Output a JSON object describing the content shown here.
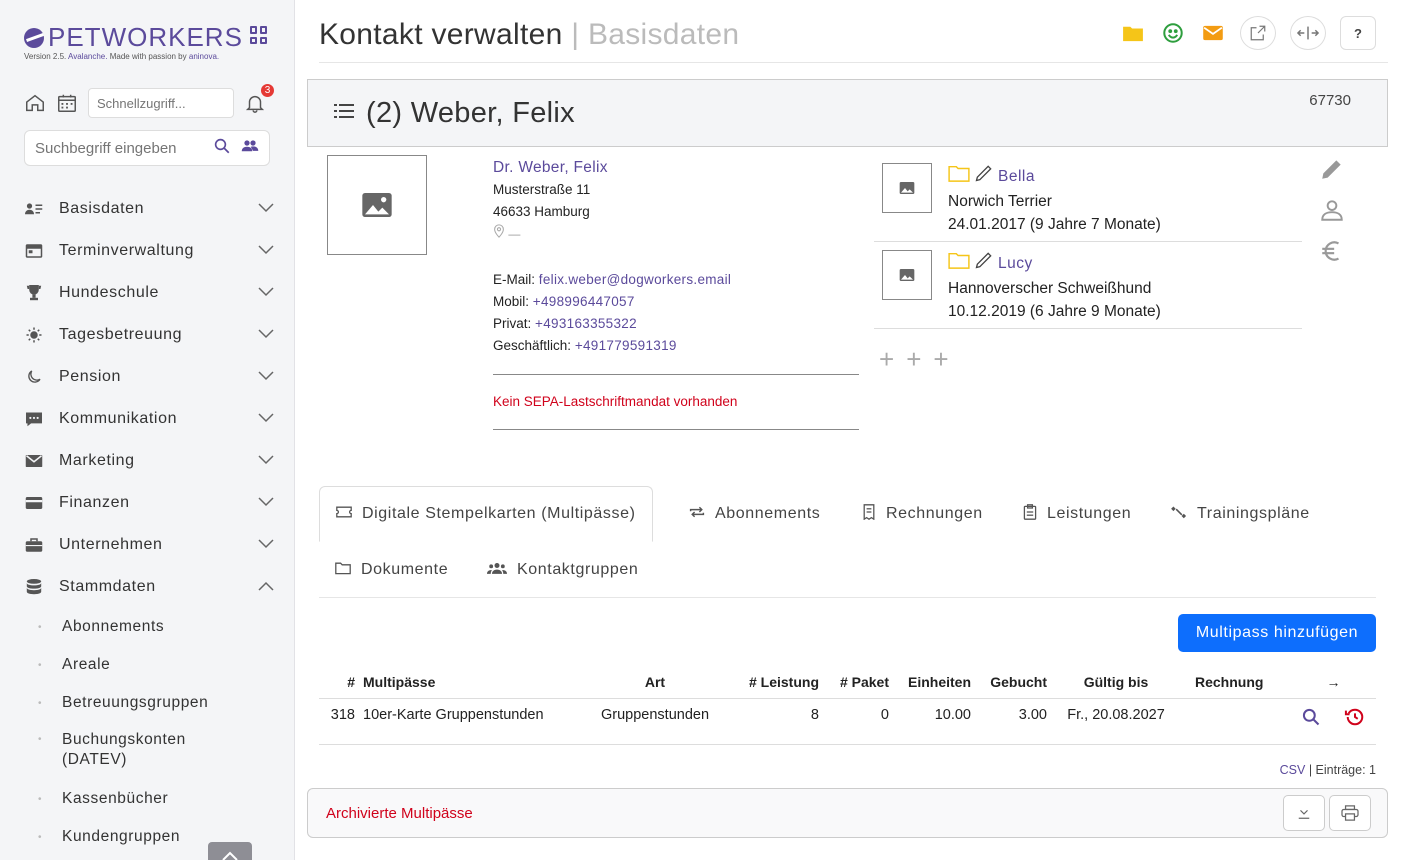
{
  "brand": {
    "name": "PETWORKERS",
    "version_prefix": "Version 2.5.",
    "version_name": "Avalanche.",
    "version_suffix": "Made with passion by",
    "vendor": "aninova."
  },
  "quick": {
    "placeholder": "Schnellzugriff...",
    "notifications": "3"
  },
  "search": {
    "placeholder": "Suchbegriff eingeben"
  },
  "nav": [
    {
      "label": "Basisdaten",
      "icon": "contact-card-icon"
    },
    {
      "label": "Terminverwaltung",
      "icon": "calendar-icon"
    },
    {
      "label": "Hundeschule",
      "icon": "trophy-icon"
    },
    {
      "label": "Tagesbetreuung",
      "icon": "sun-icon"
    },
    {
      "label": "Pension",
      "icon": "moon-icon"
    },
    {
      "label": "Kommunikation",
      "icon": "chat-icon"
    },
    {
      "label": "Marketing",
      "icon": "envelope-icon"
    },
    {
      "label": "Finanzen",
      "icon": "credit-card-icon"
    },
    {
      "label": "Unternehmen",
      "icon": "briefcase-icon"
    },
    {
      "label": "Stammdaten",
      "icon": "database-icon"
    }
  ],
  "stammdaten_sub": [
    "Abonnements",
    "Areale",
    "Betreuungsgruppen",
    "Buchungskonten (DATEV)",
    "Kassenbücher",
    "Kundengruppen"
  ],
  "header": {
    "title": "Kontakt verwalten",
    "separator": "|",
    "crumb": "Basisdaten",
    "help": "?"
  },
  "contact": {
    "heading": "(2) Weber, Felix",
    "id": "67730",
    "name": "Dr. Weber, Felix",
    "street": "Musterstraße 11",
    "city": "46633 Hamburg",
    "location": "—",
    "email_label": "E-Mail:",
    "email": "felix.weber@dogworkers.email",
    "mobile_label": "Mobil:",
    "mobile": "+498996447057",
    "private_label": "Privat:",
    "private": "+493163355322",
    "business_label": "Geschäftlich:",
    "business": "+491779591319",
    "sepa": "Kein SEPA-Lastschriftmandat vorhanden"
  },
  "pets": [
    {
      "name": "Bella",
      "breed": "Norwich Terrier",
      "birth": "24.01.2017 (9 Jahre 7 Monate)"
    },
    {
      "name": "Lucy",
      "breed": "Hannoverscher Schweißhund",
      "birth": "10.12.2019 (6 Jahre 9 Monate)"
    }
  ],
  "tabs": [
    "Digitale Stempelkarten (Multipässe)",
    "Abonnements",
    "Rechnungen",
    "Leistungen",
    "Trainingspläne",
    "Dokumente",
    "Kontaktgruppen"
  ],
  "add_button": "Multipass hinzufügen",
  "table": {
    "headers": [
      "#",
      "Multipässe",
      "Art",
      "# Leistung",
      "# Paket",
      "Einheiten",
      "Gebucht",
      "Gültig bis",
      "Rechnung",
      "→"
    ],
    "rows": [
      [
        "318",
        "10er-Karte Gruppenstunden",
        "Gruppenstunden",
        "8",
        "0",
        "10.00",
        "3.00",
        "Fr., 20.08.2027",
        ""
      ]
    ]
  },
  "footer": {
    "csv": "CSV",
    "entries": "| Einträge: 1"
  },
  "archive": {
    "label": "Archivierte Multipässe"
  },
  "colors": {
    "brand": "#5b4a9b",
    "primary": "#0d6efd",
    "danger": "#d0021b",
    "folder": "#f5c518",
    "smile": "#2e9e3e",
    "mail": "#f39c12"
  }
}
